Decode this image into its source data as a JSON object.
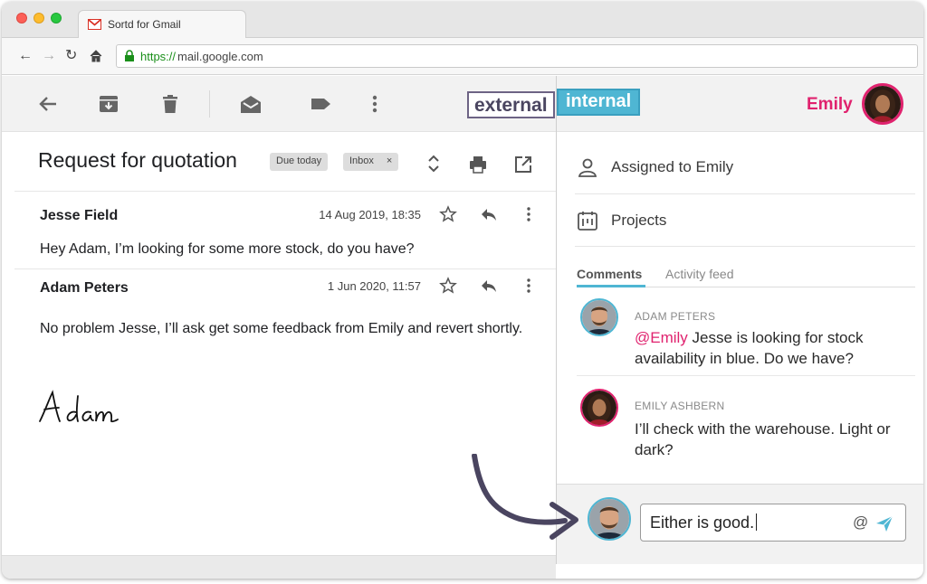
{
  "browser": {
    "tab_title": "Sortd for Gmail",
    "url_scheme": "https://",
    "url_rest": "mail.google.com"
  },
  "gmail": {
    "subject": "Request for quotation",
    "chips": [
      "Due today",
      "Inbox"
    ],
    "chip_close": "×",
    "messages": [
      {
        "sender": "Jesse Field",
        "date": "14 Aug 2019, 18:35",
        "body": "Hey Adam, I’m looking for some more stock, do you have?"
      },
      {
        "sender": "Adam Peters",
        "date": "1 Jun 2020, 11:57",
        "body": "No problem Jesse, I’ll ask get some feedback from Emily and revert shortly."
      }
    ],
    "signature": "Adam"
  },
  "labels": {
    "external": "external",
    "internal": "internal"
  },
  "panel": {
    "user_name": "Emily",
    "assigned": "Assigned to Emily",
    "projects": "Projects",
    "tabs": [
      "Comments",
      "Activity feed"
    ],
    "comments": [
      {
        "author": "ADAM PETERS",
        "mention": "@Emily",
        "text": " Jesse is looking for stock availability in blue. Do we have?"
      },
      {
        "author": "EMILY ASHBERN",
        "mention": "",
        "text": "I’ll check with the warehouse. Light or dark?"
      }
    ],
    "composer": {
      "value": "Either is good.",
      "at_symbol": "@"
    }
  },
  "colors": {
    "accent_pink": "#e0226e",
    "accent_blue": "#4fb6d3",
    "label_purple": "#4a4560"
  }
}
